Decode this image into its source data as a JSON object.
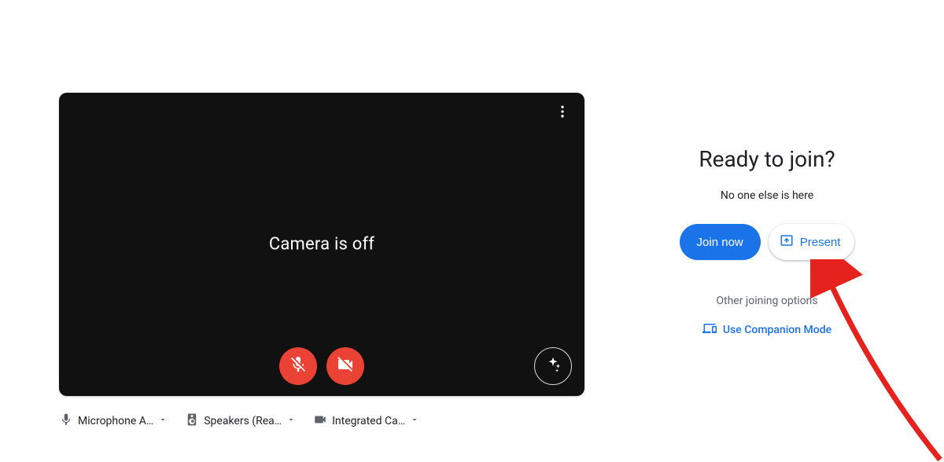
{
  "preview": {
    "camera_status_text": "Camera is off"
  },
  "devices": {
    "microphone_label": "Microphone A…",
    "speakers_label": "Speakers (Rea…",
    "camera_label": "Integrated Ca…"
  },
  "join": {
    "title": "Ready to join?",
    "presence_text": "No one else is here",
    "join_label": "Join now",
    "present_label": "Present",
    "other_options_label": "Other joining options",
    "companion_label": "Use Companion Mode"
  }
}
